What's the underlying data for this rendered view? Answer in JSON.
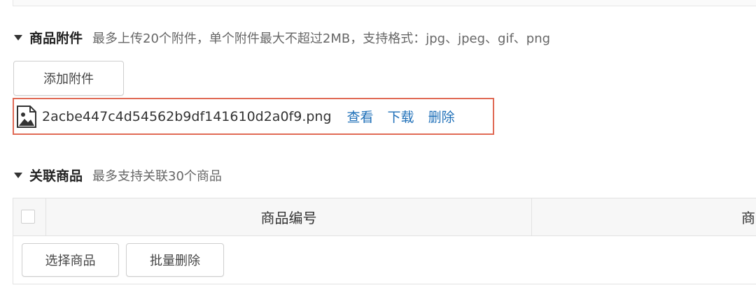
{
  "attachments": {
    "title": "商品附件",
    "hint": "最多上传20个附件，单个附件最大不超过2MB，支持格式：jpg、jpeg、gif、png",
    "add_button": "添加附件",
    "files": [
      {
        "name": "2acbe447c4d54562b9df141610d2a0f9.png",
        "icon": "image-file-icon",
        "view_label": "查看",
        "download_label": "下载",
        "delete_label": "删除"
      }
    ]
  },
  "related_products": {
    "title": "关联商品",
    "hint": "最多支持关联30个商品",
    "columns": [
      "商品编号",
      "商"
    ],
    "select_button": "选择商品",
    "batch_delete_button": "批量删除"
  },
  "colors": {
    "link": "#1e6fb8",
    "highlight_border": "#e06a55"
  }
}
